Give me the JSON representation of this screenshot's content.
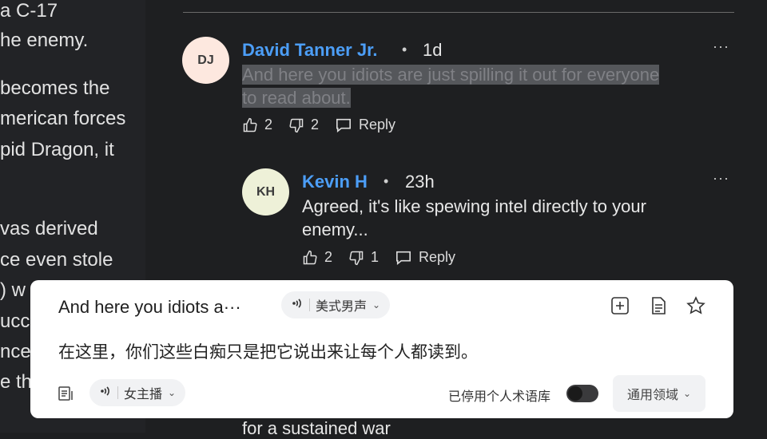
{
  "article": {
    "lines": [
      "a C-17",
      "he enemy.",
      "becomes the",
      "merican forces",
      "pid Dragon, it",
      "vas derived",
      "ce even stole",
      ") w",
      "ucce",
      "nce",
      "e th"
    ]
  },
  "comments": [
    {
      "initials": "DJ",
      "author": "David Tanner Jr.",
      "time": "1d",
      "text_highlighted_1": "And here you idiots are just spilling it out for everyone",
      "text_highlighted_2": "to read about.",
      "likes": "2",
      "dislikes": "2",
      "reply_label": "Reply",
      "more": "···",
      "avatar_color": "#fde8df"
    },
    {
      "initials": "KH",
      "author": "Kevin H",
      "time": "23h",
      "text_1": "Agreed, it's like spewing intel directly to your",
      "text_2": "enemy...",
      "likes": "2",
      "dislikes": "1",
      "reply_label": "Reply",
      "more": "···",
      "avatar_color": "#eef1d8"
    }
  ],
  "translate_popup": {
    "source_text": "And here you idiots a···",
    "source_voice": "美式男声",
    "translation": "在这里，你们这些白痴只是把它说出来让每个人都读到。",
    "target_voice": "女主播",
    "personal_corpus_label": "已停用个人术语库",
    "domain_label": "通用领域",
    "toggle_on": false
  },
  "bottom_peek_text": "for a sustained war",
  "colors": {
    "accent_link": "#4c9ef7",
    "page_bg": "#1e1f21",
    "popup_bg": "#ffffff"
  }
}
